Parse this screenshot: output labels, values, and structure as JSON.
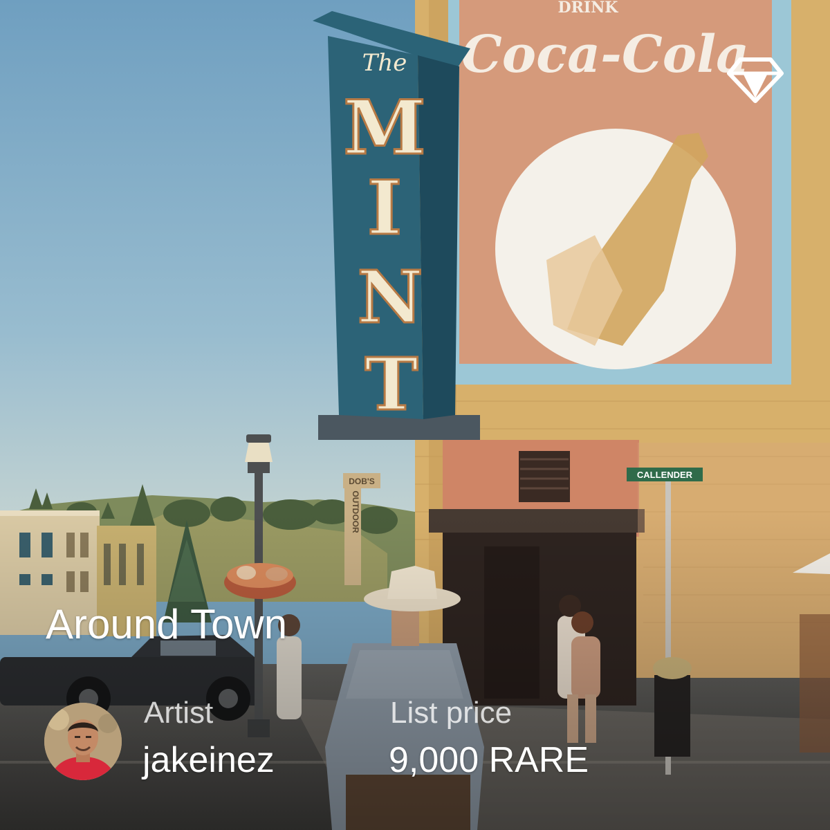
{
  "card": {
    "title": "Around Town",
    "artist_label": "Artist",
    "artist_name": "jakeinez",
    "price_label": "List price",
    "price_value": "9,000 RARE",
    "badge_icon": "diamond-icon"
  },
  "photo": {
    "signs": {
      "mint_top": "The",
      "mint_letters": [
        "M",
        "I",
        "N",
        "T"
      ],
      "mural_top": "DRINK",
      "mural_brand": "Coca-Cola",
      "street_sign": "CALLENDER",
      "store_sign_top": "DOB'S",
      "store_sign_bottom": "OUTDOOR"
    }
  },
  "colors": {
    "sky": "#7fa9c6",
    "mural": "#d59a7b",
    "mural_border": "#9cc7d6",
    "building": "#d8b06a",
    "sign_teal": "#2c6377",
    "text": "#ffffff"
  }
}
